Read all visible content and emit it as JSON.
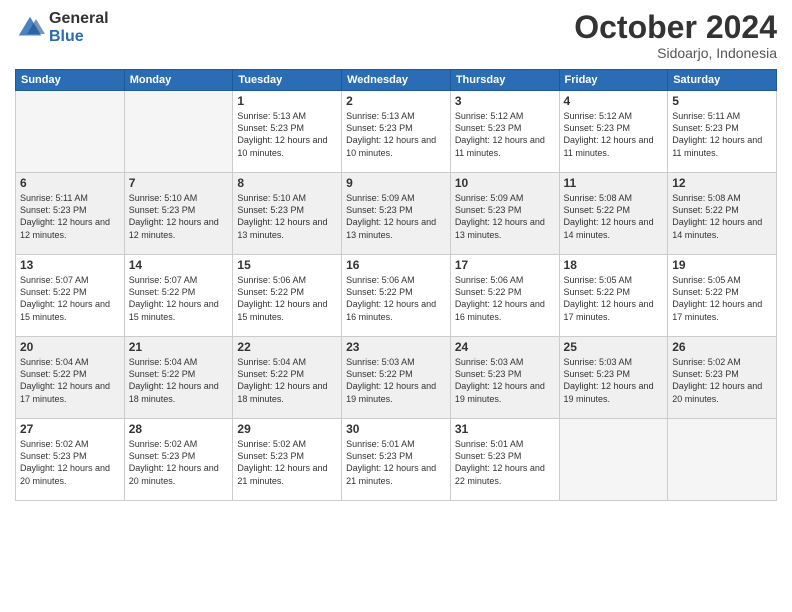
{
  "logo": {
    "general": "General",
    "blue": "Blue"
  },
  "header": {
    "month": "October 2024",
    "location": "Sidoarjo, Indonesia"
  },
  "weekdays": [
    "Sunday",
    "Monday",
    "Tuesday",
    "Wednesday",
    "Thursday",
    "Friday",
    "Saturday"
  ],
  "weeks": [
    [
      {
        "day": "",
        "detail": ""
      },
      {
        "day": "",
        "detail": ""
      },
      {
        "day": "1",
        "detail": "Sunrise: 5:13 AM\nSunset: 5:23 PM\nDaylight: 12 hours\nand 10 minutes."
      },
      {
        "day": "2",
        "detail": "Sunrise: 5:13 AM\nSunset: 5:23 PM\nDaylight: 12 hours\nand 10 minutes."
      },
      {
        "day": "3",
        "detail": "Sunrise: 5:12 AM\nSunset: 5:23 PM\nDaylight: 12 hours\nand 11 minutes."
      },
      {
        "day": "4",
        "detail": "Sunrise: 5:12 AM\nSunset: 5:23 PM\nDaylight: 12 hours\nand 11 minutes."
      },
      {
        "day": "5",
        "detail": "Sunrise: 5:11 AM\nSunset: 5:23 PM\nDaylight: 12 hours\nand 11 minutes."
      }
    ],
    [
      {
        "day": "6",
        "detail": "Sunrise: 5:11 AM\nSunset: 5:23 PM\nDaylight: 12 hours\nand 12 minutes."
      },
      {
        "day": "7",
        "detail": "Sunrise: 5:10 AM\nSunset: 5:23 PM\nDaylight: 12 hours\nand 12 minutes."
      },
      {
        "day": "8",
        "detail": "Sunrise: 5:10 AM\nSunset: 5:23 PM\nDaylight: 12 hours\nand 13 minutes."
      },
      {
        "day": "9",
        "detail": "Sunrise: 5:09 AM\nSunset: 5:23 PM\nDaylight: 12 hours\nand 13 minutes."
      },
      {
        "day": "10",
        "detail": "Sunrise: 5:09 AM\nSunset: 5:23 PM\nDaylight: 12 hours\nand 13 minutes."
      },
      {
        "day": "11",
        "detail": "Sunrise: 5:08 AM\nSunset: 5:22 PM\nDaylight: 12 hours\nand 14 minutes."
      },
      {
        "day": "12",
        "detail": "Sunrise: 5:08 AM\nSunset: 5:22 PM\nDaylight: 12 hours\nand 14 minutes."
      }
    ],
    [
      {
        "day": "13",
        "detail": "Sunrise: 5:07 AM\nSunset: 5:22 PM\nDaylight: 12 hours\nand 15 minutes."
      },
      {
        "day": "14",
        "detail": "Sunrise: 5:07 AM\nSunset: 5:22 PM\nDaylight: 12 hours\nand 15 minutes."
      },
      {
        "day": "15",
        "detail": "Sunrise: 5:06 AM\nSunset: 5:22 PM\nDaylight: 12 hours\nand 15 minutes."
      },
      {
        "day": "16",
        "detail": "Sunrise: 5:06 AM\nSunset: 5:22 PM\nDaylight: 12 hours\nand 16 minutes."
      },
      {
        "day": "17",
        "detail": "Sunrise: 5:06 AM\nSunset: 5:22 PM\nDaylight: 12 hours\nand 16 minutes."
      },
      {
        "day": "18",
        "detail": "Sunrise: 5:05 AM\nSunset: 5:22 PM\nDaylight: 12 hours\nand 17 minutes."
      },
      {
        "day": "19",
        "detail": "Sunrise: 5:05 AM\nSunset: 5:22 PM\nDaylight: 12 hours\nand 17 minutes."
      }
    ],
    [
      {
        "day": "20",
        "detail": "Sunrise: 5:04 AM\nSunset: 5:22 PM\nDaylight: 12 hours\nand 17 minutes."
      },
      {
        "day": "21",
        "detail": "Sunrise: 5:04 AM\nSunset: 5:22 PM\nDaylight: 12 hours\nand 18 minutes."
      },
      {
        "day": "22",
        "detail": "Sunrise: 5:04 AM\nSunset: 5:22 PM\nDaylight: 12 hours\nand 18 minutes."
      },
      {
        "day": "23",
        "detail": "Sunrise: 5:03 AM\nSunset: 5:22 PM\nDaylight: 12 hours\nand 19 minutes."
      },
      {
        "day": "24",
        "detail": "Sunrise: 5:03 AM\nSunset: 5:23 PM\nDaylight: 12 hours\nand 19 minutes."
      },
      {
        "day": "25",
        "detail": "Sunrise: 5:03 AM\nSunset: 5:23 PM\nDaylight: 12 hours\nand 19 minutes."
      },
      {
        "day": "26",
        "detail": "Sunrise: 5:02 AM\nSunset: 5:23 PM\nDaylight: 12 hours\nand 20 minutes."
      }
    ],
    [
      {
        "day": "27",
        "detail": "Sunrise: 5:02 AM\nSunset: 5:23 PM\nDaylight: 12 hours\nand 20 minutes."
      },
      {
        "day": "28",
        "detail": "Sunrise: 5:02 AM\nSunset: 5:23 PM\nDaylight: 12 hours\nand 20 minutes."
      },
      {
        "day": "29",
        "detail": "Sunrise: 5:02 AM\nSunset: 5:23 PM\nDaylight: 12 hours\nand 21 minutes."
      },
      {
        "day": "30",
        "detail": "Sunrise: 5:01 AM\nSunset: 5:23 PM\nDaylight: 12 hours\nand 21 minutes."
      },
      {
        "day": "31",
        "detail": "Sunrise: 5:01 AM\nSunset: 5:23 PM\nDaylight: 12 hours\nand 22 minutes."
      },
      {
        "day": "",
        "detail": ""
      },
      {
        "day": "",
        "detail": ""
      }
    ]
  ]
}
